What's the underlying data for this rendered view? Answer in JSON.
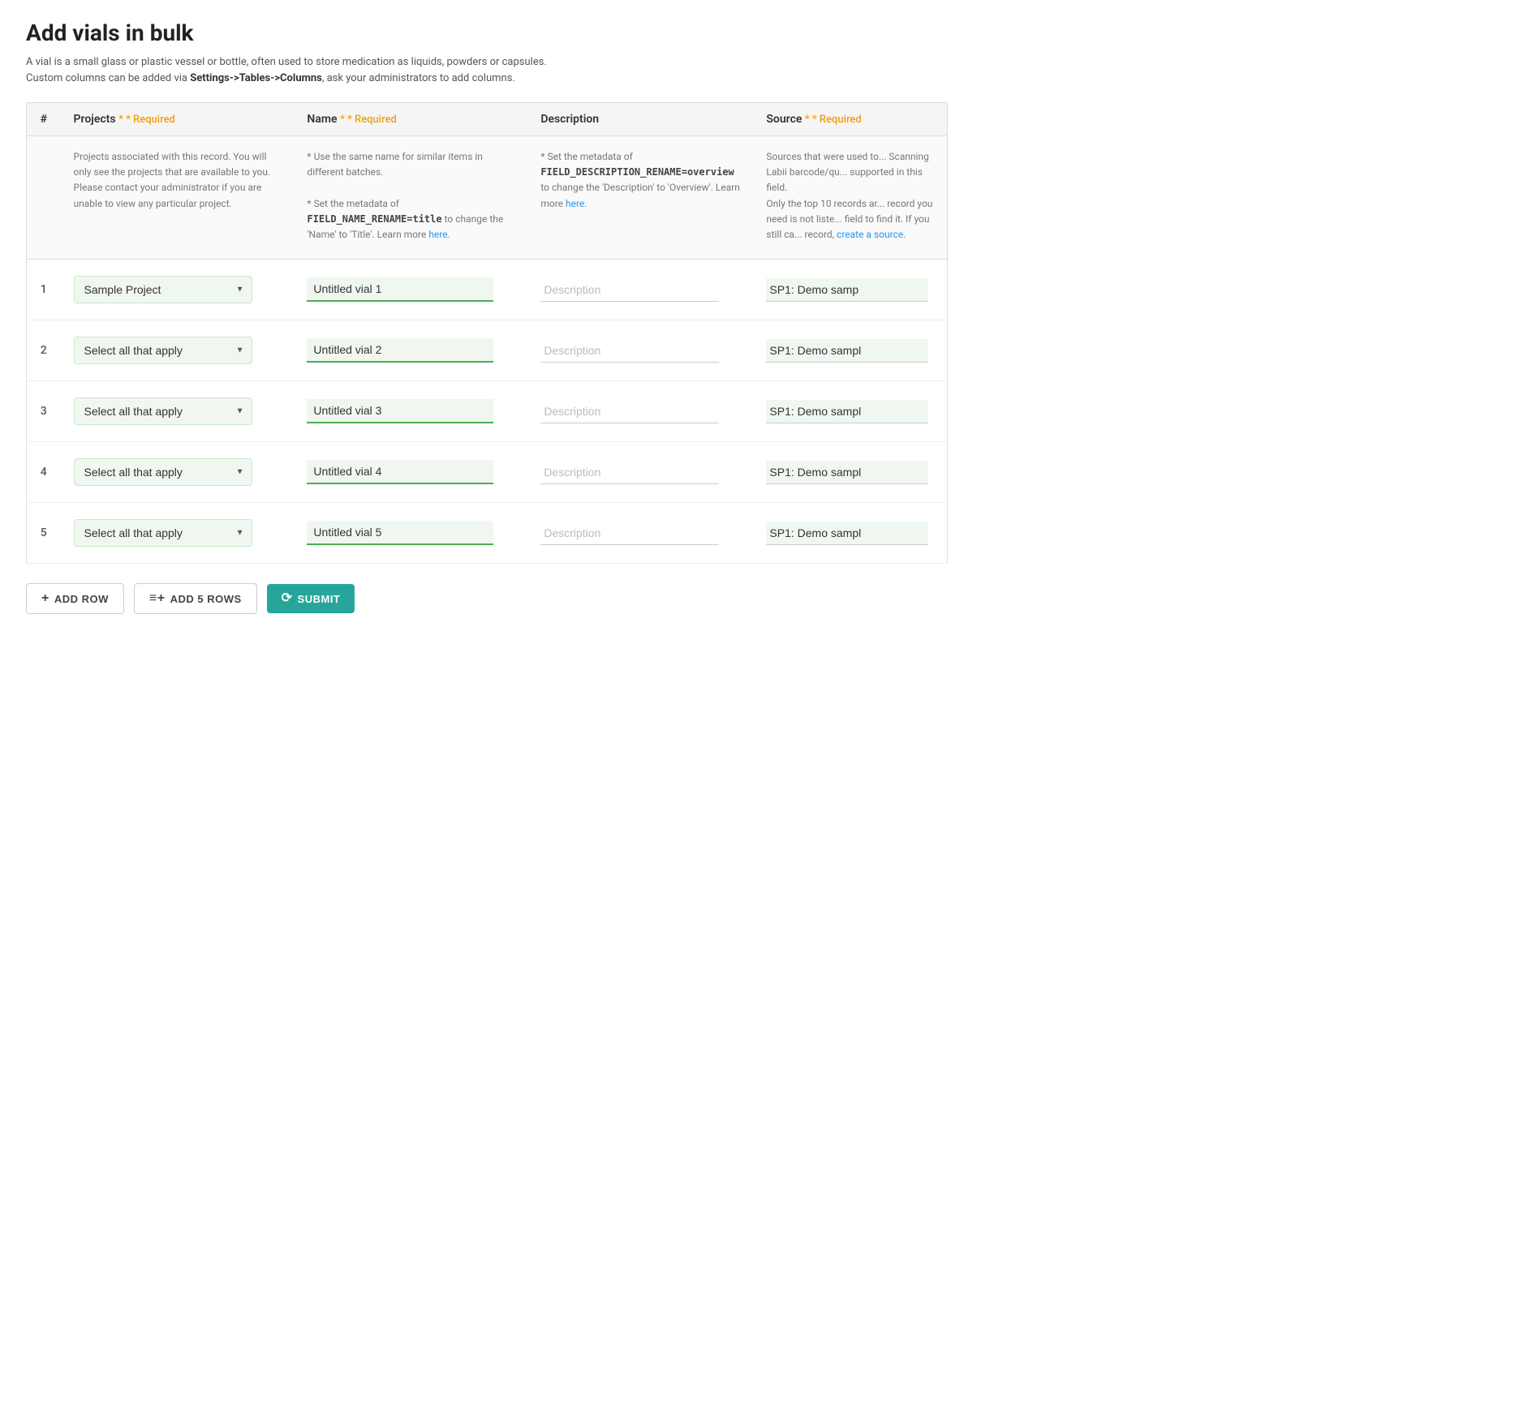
{
  "page": {
    "title": "Add vials in bulk",
    "subtitle_text": "A vial is a small glass or plastic vessel or bottle, often used to store medication as liquids, powders or capsules.",
    "subtitle_text2": "Custom columns can be added via ",
    "subtitle_link_text": "Settings->Tables->Columns",
    "subtitle_text3": ", ask your administrators to add columns."
  },
  "table": {
    "columns": [
      {
        "id": "num",
        "label": "#"
      },
      {
        "id": "projects",
        "label": "Projects",
        "required": true
      },
      {
        "id": "name",
        "label": "Name",
        "required": true
      },
      {
        "id": "description",
        "label": "Description",
        "required": false
      },
      {
        "id": "source",
        "label": "Source",
        "required": true
      }
    ],
    "info_row": {
      "projects_info": "Projects associated with this record. You will only see the projects that are available to you. Please contact your administrator if you are unable to view any particular project.",
      "name_info_1": "* Use the same name for similar items in different batches.",
      "name_info_2": "* Set the metadata of FIELD_NAME_RENAME=title to change the 'Name' to 'Title'. Learn more here.",
      "name_field_code": "FIELD_NAME_RENAME=title",
      "name_link": "here",
      "desc_info_1": "* Set the metadata of FIELD_DESCRIPTION_RENAME=overview to change the 'Description' to 'Overview'. Learn more here.",
      "desc_field_code": "FIELD_DESCRIPTION_RENAME=overview",
      "desc_link": "here",
      "source_info": "Sources that were used to... Scanning Labii barcode/qu... supported in this field. Only the top 10 records ar... record you need is not liste... field to find it. If you still ca... record, create a source.",
      "source_link": "create a source"
    },
    "rows": [
      {
        "num": "1",
        "project": "Sample Project",
        "project_filled": true,
        "name": "Untitled vial 1",
        "description": "",
        "desc_placeholder": "Description",
        "source": "SP1: Demo samp"
      },
      {
        "num": "2",
        "project": "Select all that apply",
        "project_filled": false,
        "name": "Untitled vial 2",
        "description": "",
        "desc_placeholder": "Description",
        "source": "SP1: Demo sampl"
      },
      {
        "num": "3",
        "project": "Select all that apply",
        "project_filled": false,
        "name": "Untitled vial 3",
        "description": "",
        "desc_placeholder": "Description",
        "source": "SP1: Demo sampl"
      },
      {
        "num": "4",
        "project": "Select all that apply",
        "project_filled": false,
        "name": "Untitled vial 4",
        "description": "",
        "desc_placeholder": "Description",
        "source": "SP1: Demo sampl"
      },
      {
        "num": "5",
        "project": "Select all that apply",
        "project_filled": false,
        "name": "Untitled vial 5",
        "description": "",
        "desc_placeholder": "Description",
        "source": "SP1: Demo sampl"
      }
    ]
  },
  "footer": {
    "add_row_label": "ADD ROW",
    "add_5_rows_label": "ADD 5 ROWS",
    "submit_label": "SUBMIT",
    "required_label": "* Required"
  },
  "colors": {
    "required_color": "#f59e0b",
    "green_border": "#4caf50",
    "teal_btn": "#26a69a",
    "link_blue": "#2196F3"
  }
}
